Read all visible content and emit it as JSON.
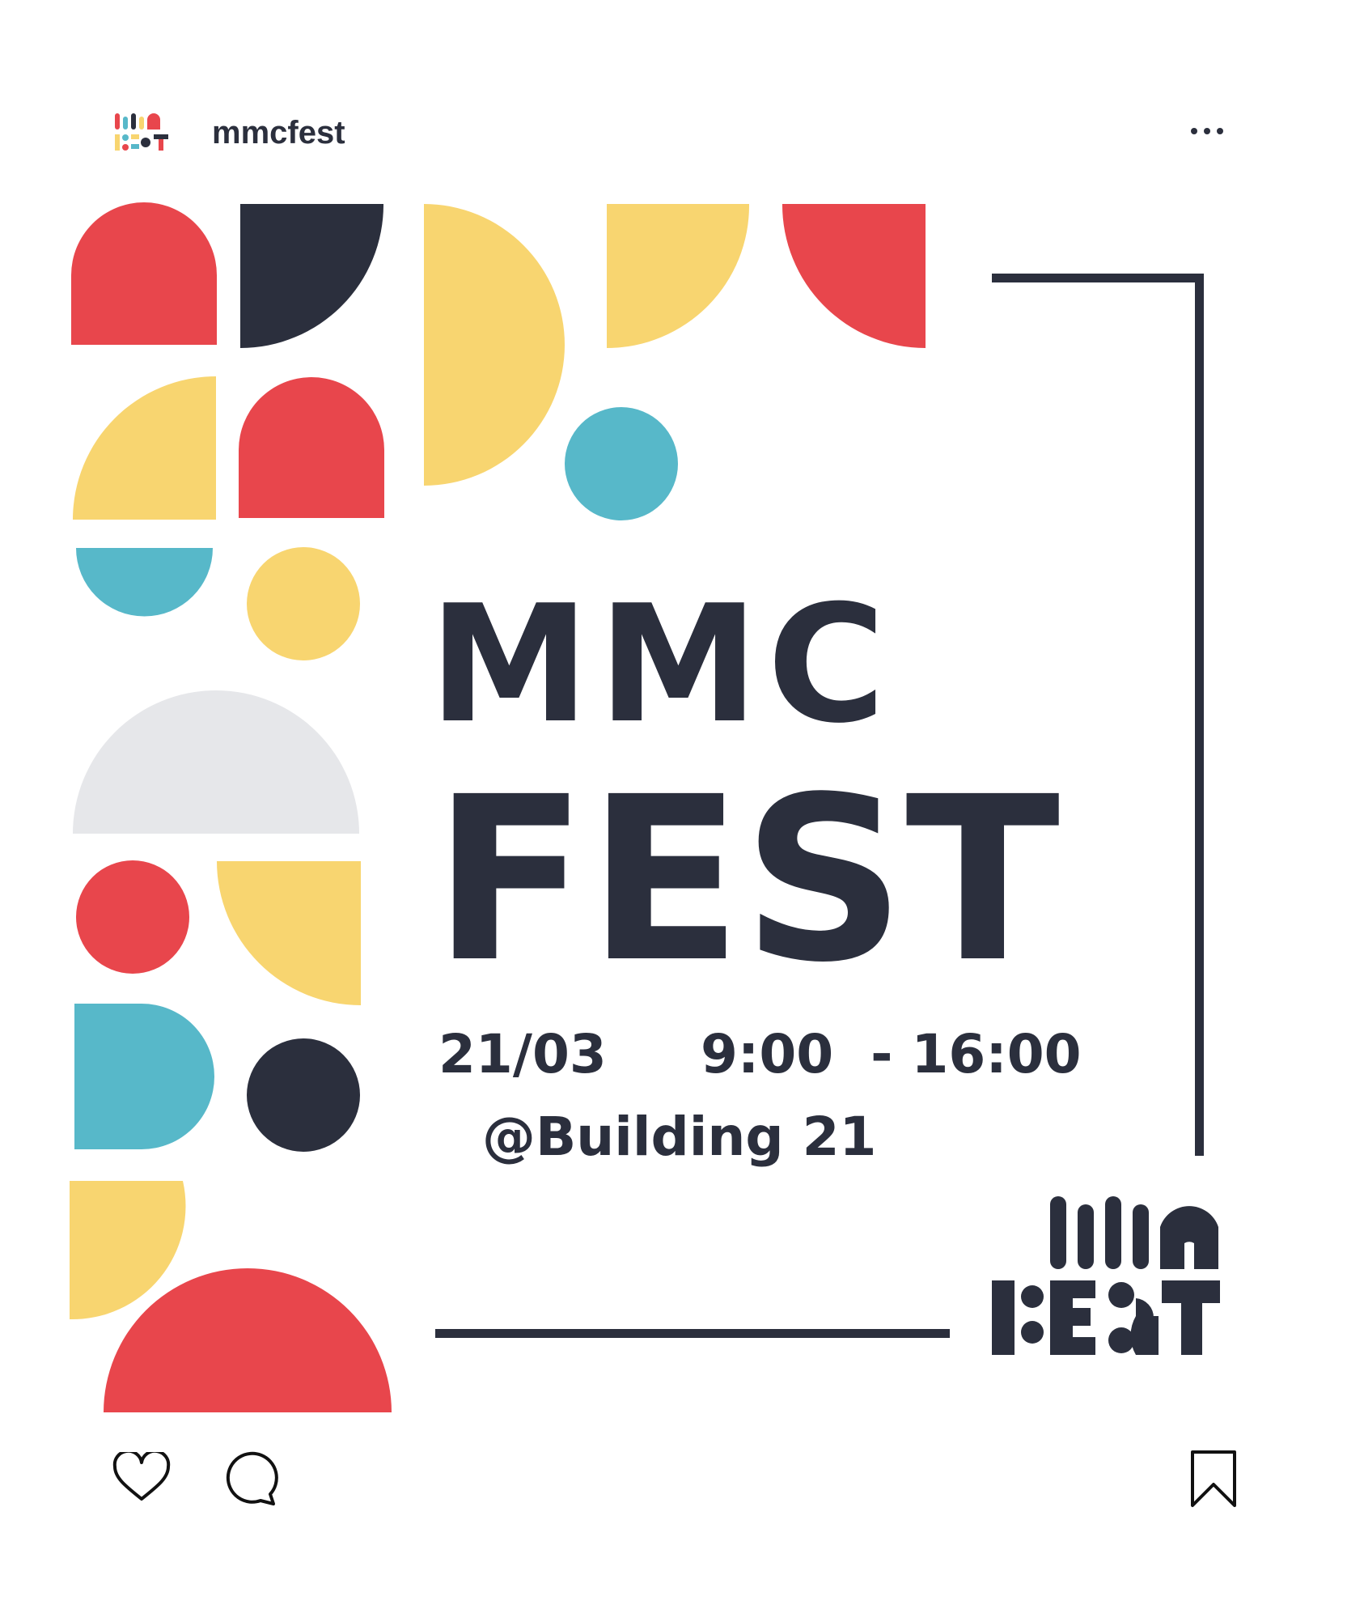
{
  "account": {
    "username": "mmcfest",
    "avatar_icon": "mmc-fest-logo-icon",
    "more_icon": "more-options-icon"
  },
  "poster": {
    "title_line1": "MMC",
    "title_line2": "FEST",
    "date": "21/03",
    "time": "9:00  - 16:00",
    "location": "@Building 21",
    "logo_icon": "mmc-fest-logo-icon",
    "colors": {
      "red": "#e8464c",
      "navy": "#2b2f3d",
      "yellow": "#f8d570",
      "teal": "#57b8c9",
      "gray": "#e6e7ea"
    }
  },
  "actions": {
    "like_icon": "heart-icon",
    "comment_icon": "comment-icon",
    "save_icon": "bookmark-icon"
  }
}
